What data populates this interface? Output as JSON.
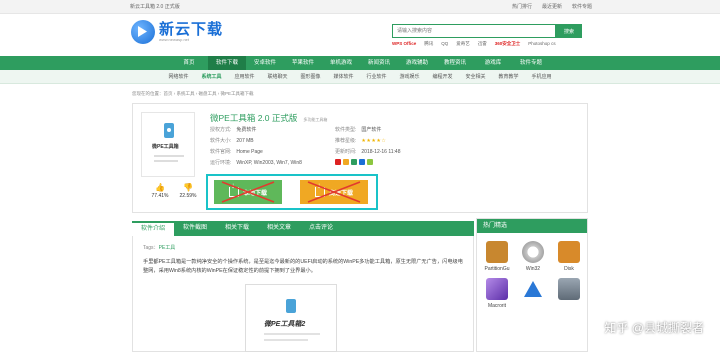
{
  "topbar": {
    "site_tag": "新云工具箱 2.0 正式版",
    "links": [
      "热门排行",
      "最近更新",
      "软件专题"
    ]
  },
  "brand": {
    "name": "新云下载",
    "url": "www.newasp.net"
  },
  "search": {
    "placeholder": "请输入搜索内容",
    "button": "搜索",
    "hot": [
      "WPS Office",
      "迅雷",
      "360安全卫士",
      "Photoshop cs"
    ],
    "hot_extra": [
      "腾讯",
      "QQ",
      "爱奇艺"
    ]
  },
  "nav": {
    "items": [
      "首页",
      "软件下载",
      "安卓软件",
      "苹果软件",
      "单机游戏",
      "新闻资讯",
      "游戏辅助",
      "教程资讯",
      "游戏库",
      "软件专题"
    ],
    "active_index": 1
  },
  "subnav": {
    "items": [
      "网络软件",
      "系统工具",
      "应用软件",
      "联络聊天",
      "图形图像",
      "媒体软件",
      "行业软件",
      "游戏娱乐",
      "编程开发",
      "安全相关",
      "教育教学",
      "手机应用"
    ],
    "active_index": 1
  },
  "breadcrumb": "您现在的位置：首页 › 系统工具 › 磁盘工具 › 微PE工具箱下载",
  "product": {
    "thumb_name": "微PE工具箱",
    "title": "微PE工具箱 2.0 正式版",
    "size_note": "多功能工具箱",
    "info": [
      {
        "k": "授权方式:",
        "v": "免费软件"
      },
      {
        "k": "软件类型:",
        "v": "国产软件"
      },
      {
        "k": "软件大小:",
        "v": "207 MB"
      },
      {
        "k": "推荐星级:",
        "v": "★★★★☆"
      },
      {
        "k": "软件官网:",
        "v": "Home Page"
      },
      {
        "k": "更新时间:",
        "v": "2018-12-16 11:48"
      },
      {
        "k": "运行环境:",
        "v": "WinXP, Win2003, Win7, Win8"
      },
      {
        "k": "",
        "v": ""
      }
    ],
    "votes": {
      "up": "77.41%",
      "down": "22.59%"
    },
    "buttons": {
      "local": "本地下载",
      "fast": "高速下载"
    }
  },
  "tabs": {
    "items": [
      "软件介绍",
      "软件截图",
      "相关下载",
      "相关文章",
      "点击评论"
    ],
    "active_index": 0
  },
  "article": {
    "tags_label": "Tags：",
    "tag": "PE工具",
    "desc": "手里都PE工具箱是一款纯净安全的个操作系统，是至是迄今最新的的UEFI启动的系统的WinPE多功能工具箱，原生无限广无广告，闪电级电整网，采用Win8系统内核的WinPE在保证稳定性的前提下拥到了业界最小。",
    "shot_name": "微PE工具箱2"
  },
  "sidebar": {
    "title": "热门精选",
    "apps": [
      {
        "name": "PartitionGu",
        "color": "#c8872f"
      },
      {
        "name": "Win32",
        "color": "#e0e0e0"
      },
      {
        "name": "Disk",
        "color": "#d88a2a"
      },
      {
        "name": "Macrorit",
        "color": "#7c45c2"
      },
      {
        "name": "",
        "color": "#2a78d6"
      },
      {
        "name": "",
        "color": "#6e7c8c"
      }
    ]
  },
  "watermark": {
    "text": "知乎 @县城撕裂者"
  },
  "colors": {
    "accent": "#2e9d5f",
    "highlight_border": "#19c3c8",
    "download_local": "#5fb85a",
    "download_fast": "#f0a823"
  }
}
